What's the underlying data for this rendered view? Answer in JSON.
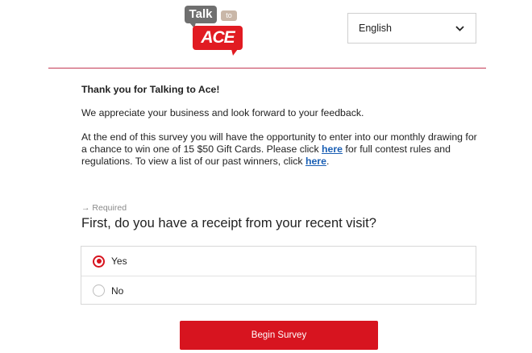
{
  "logo": {
    "talk": "Talk",
    "to": "to",
    "brand": "ACE"
  },
  "language": {
    "selected": "English",
    "icon": "chevron-down-icon"
  },
  "intro": {
    "heading": "Thank you for Talking to Ace!",
    "appreciate": "We appreciate your business and look forward to your feedback.",
    "contest_part1": "At the end of this survey you will have the opportunity to enter into our monthly drawing for a chance to win one of 15 $50 Gift Cards. Please click ",
    "link1": "here",
    "contest_part2": " for full contest rules and regulations. To view a list of our past winners, click ",
    "link2": "here",
    "contest_part3": "."
  },
  "question": {
    "required_label": "Required",
    "required_icon": "arrow-right-icon",
    "text": "First, do you have a receipt from your recent visit?",
    "options": [
      {
        "label": "Yes",
        "selected": true
      },
      {
        "label": "No",
        "selected": false
      }
    ]
  },
  "begin_button": "Begin Survey",
  "colors": {
    "accent": "#d7141f",
    "divider": "#c43a55",
    "link": "#1a5fb4"
  }
}
